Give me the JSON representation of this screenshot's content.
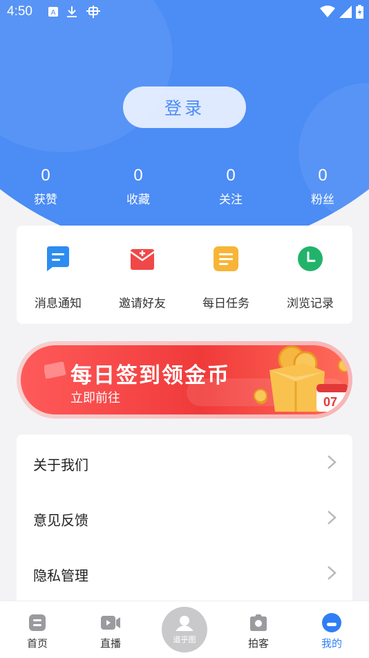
{
  "status": {
    "time": "4:50"
  },
  "header": {
    "login_label": "登录"
  },
  "stats": [
    {
      "value": "0",
      "label": "获赞"
    },
    {
      "value": "0",
      "label": "收藏"
    },
    {
      "value": "0",
      "label": "关注"
    },
    {
      "value": "0",
      "label": "粉丝"
    }
  ],
  "actions": [
    {
      "label": "消息通知",
      "icon": "message-icon",
      "color": "#2d8cf0"
    },
    {
      "label": "邀请好友",
      "icon": "red-envelope-icon",
      "color": "#f04848"
    },
    {
      "label": "每日任务",
      "icon": "task-icon",
      "color": "#f7b538"
    },
    {
      "label": "浏览记录",
      "icon": "clock-icon",
      "color": "#22b36b"
    }
  ],
  "banner": {
    "title": "每日签到领金币",
    "subtitle": "立即前往",
    "calendar_day": "07"
  },
  "menu": [
    {
      "label": "关于我们"
    },
    {
      "label": "意见反馈"
    },
    {
      "label": "隐私管理"
    }
  ],
  "tabs": [
    {
      "label": "首页",
      "icon": "home-icon"
    },
    {
      "label": "直播",
      "icon": "live-video-icon"
    },
    {
      "label": "道乎图",
      "icon": "center-logo-icon"
    },
    {
      "label": "拍客",
      "icon": "camera-icon"
    },
    {
      "label": "我的",
      "icon": "profile-icon"
    }
  ],
  "colors": {
    "primary": "#4b8cf5",
    "active_tab": "#2f7ef5",
    "inactive_tab": "#9a9a9f"
  }
}
